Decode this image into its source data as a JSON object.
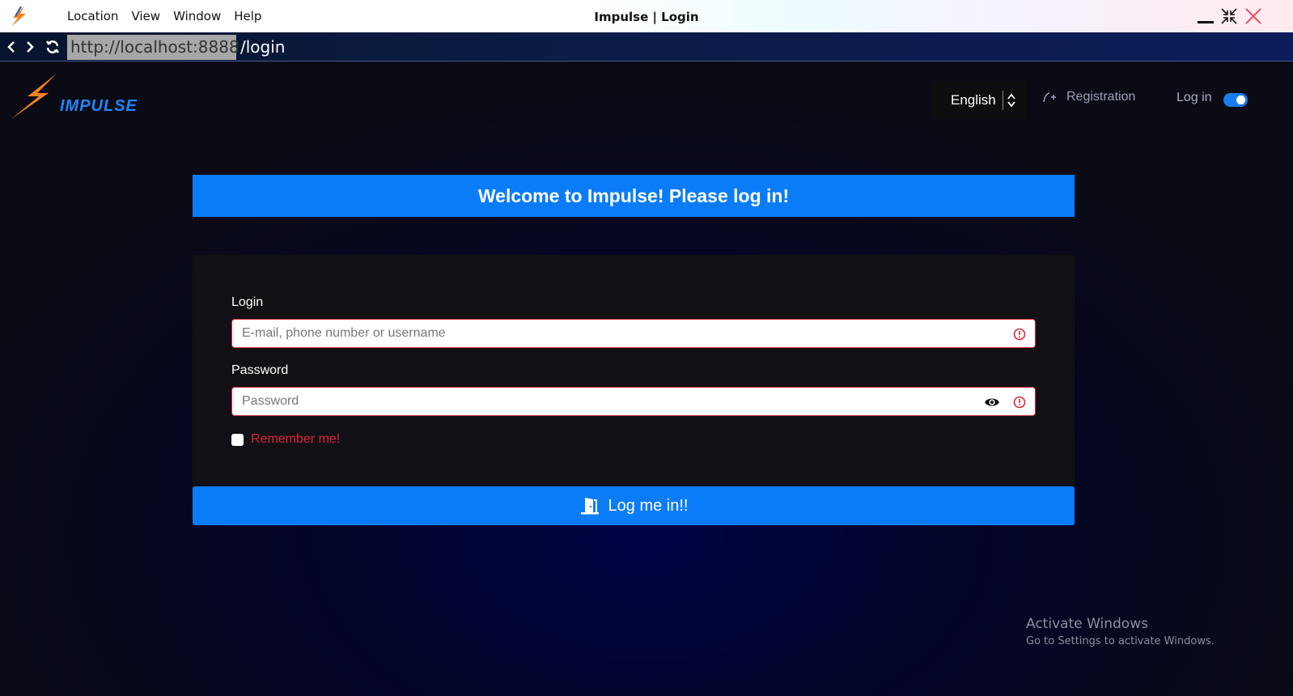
{
  "window": {
    "title": "Impulse | Login",
    "menu": [
      "Location",
      "View",
      "Window",
      "Help"
    ]
  },
  "address_bar": {
    "host": "http://localhost:8888",
    "path": "/login"
  },
  "header": {
    "logo_text": "IMPULSE",
    "language": "English",
    "registration_label": "Registration",
    "login_label": "Log in",
    "toggle_on": true
  },
  "main": {
    "welcome": "Welcome to Impulse! Please log in!",
    "login_label": "Login",
    "login_placeholder": "E-mail, phone number or username",
    "password_label": "Password",
    "password_placeholder": "Password",
    "remember_label": "Remember me!",
    "submit_label": "Log me in!!"
  },
  "os_overlay": {
    "line1": "Activate Windows",
    "line2": "Go to Settings to activate Windows."
  },
  "colors": {
    "accent": "#0a7cf8",
    "error": "#d42b3a",
    "logo_orange": "#f58220"
  }
}
